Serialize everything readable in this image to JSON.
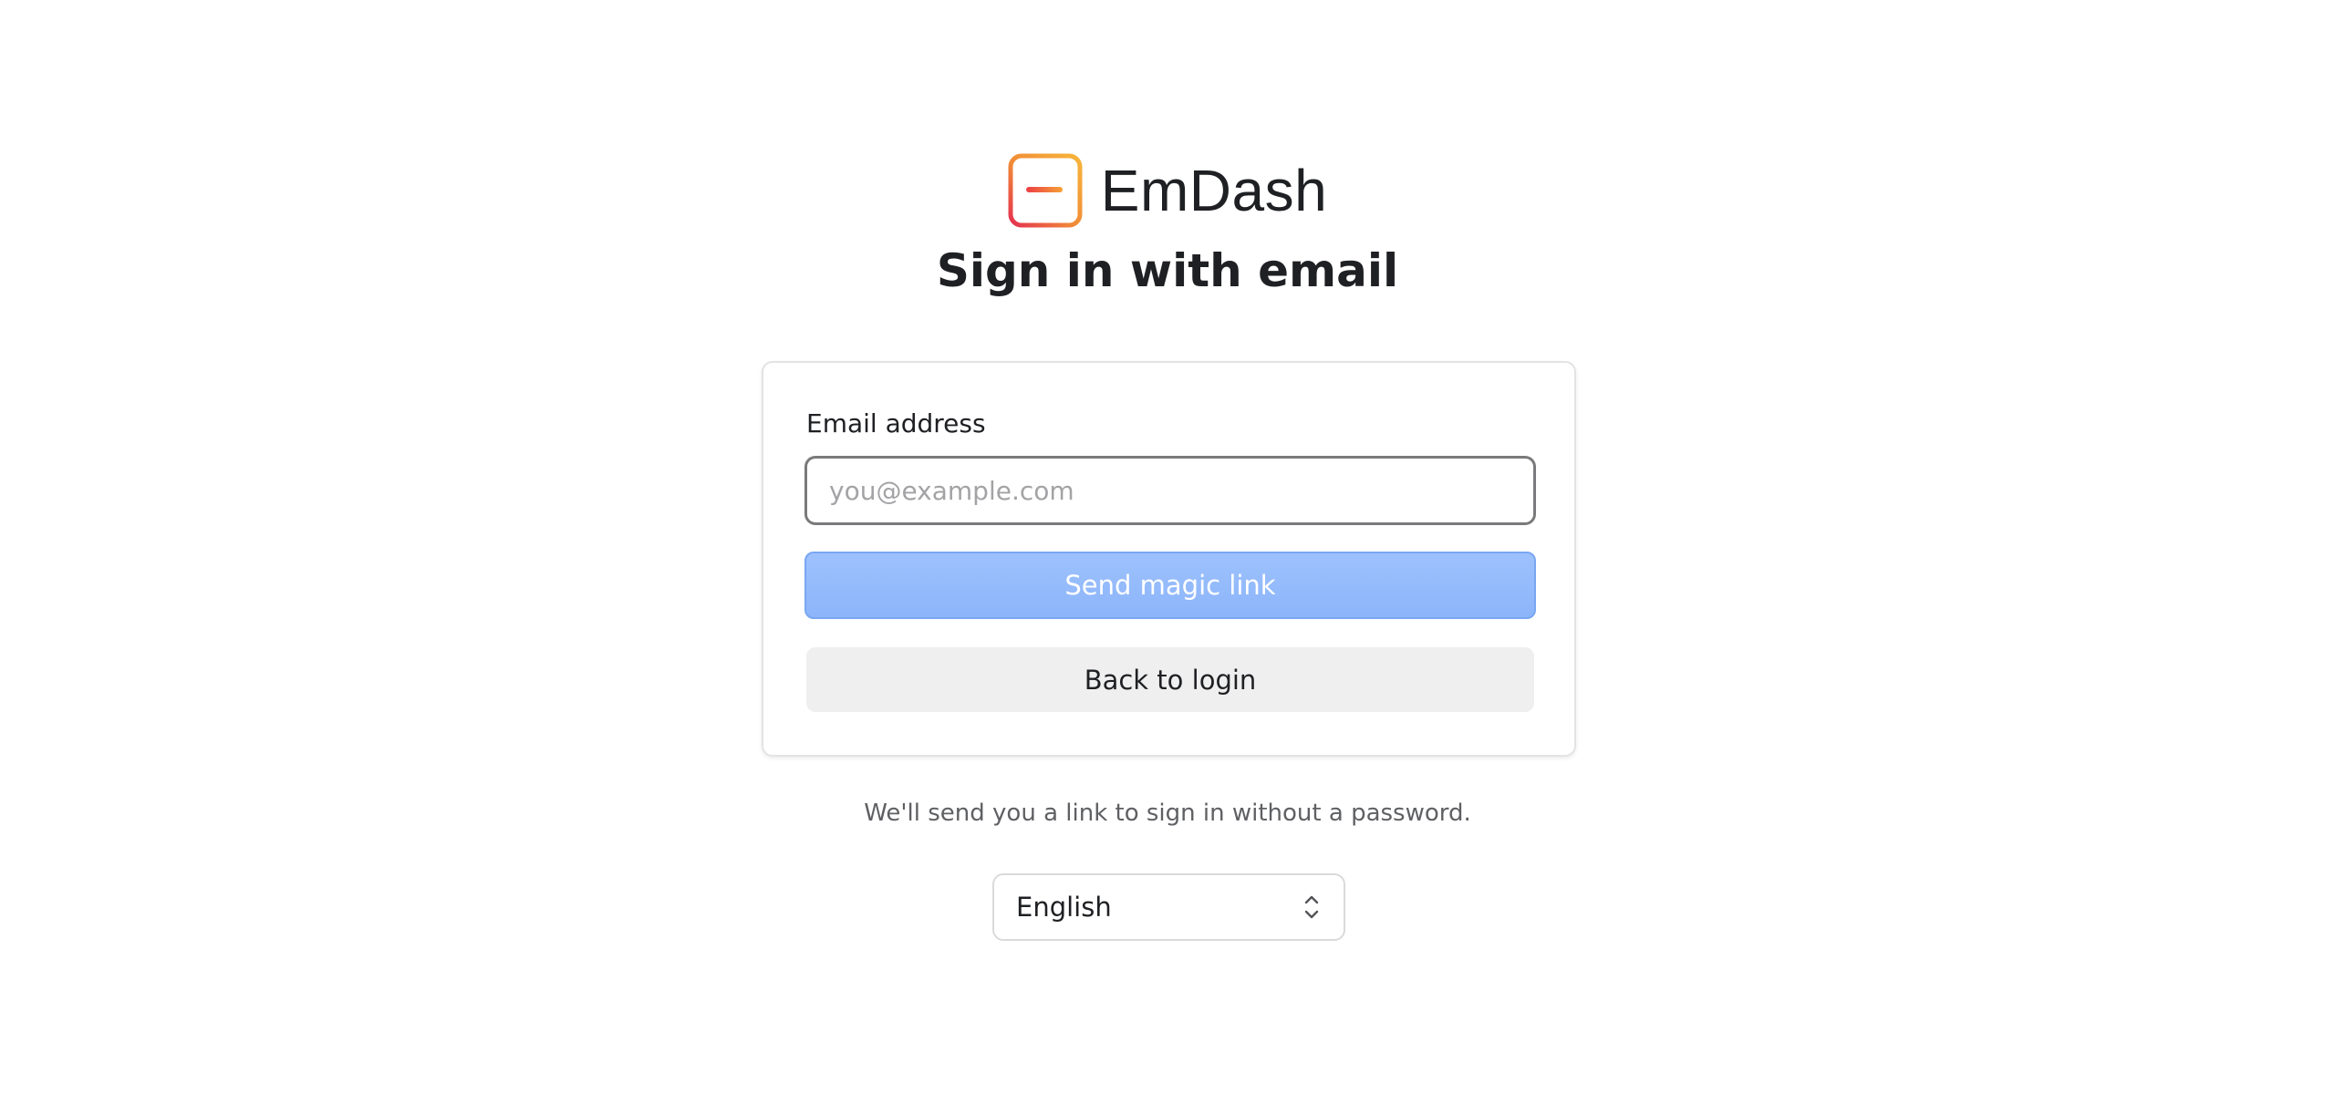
{
  "brand": {
    "name": "EmDash",
    "logo_icon": "emdash-logo-icon",
    "colors": {
      "gradient_start": "#f7a833",
      "gradient_end": "#e8334a"
    }
  },
  "page_title": "Sign in with email",
  "form": {
    "email_label": "Email address",
    "email_value": "",
    "email_placeholder": "you@example.com",
    "submit_label": "Send magic link",
    "submit_color": "#8cb5fa",
    "back_label": "Back to login"
  },
  "helper_text": "We'll send you a link to sign in without a password.",
  "language": {
    "selected": "English",
    "icon": "chevron-up-down-icon"
  }
}
